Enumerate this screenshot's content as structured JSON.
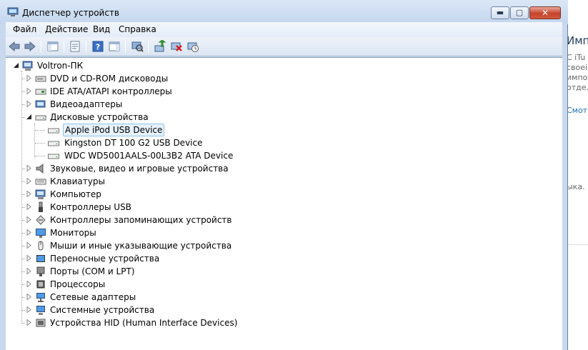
{
  "window": {
    "title": "Диспетчер устройств",
    "caption": {
      "minimize": "▬",
      "maximize": "▢",
      "close": "✕"
    }
  },
  "menu": [
    "Файл",
    "Действие",
    "Вид",
    "Справка"
  ],
  "toolbar": [
    {
      "name": "back-icon"
    },
    {
      "name": "forward-icon"
    },
    {
      "name": "show-hide-tree-icon"
    },
    {
      "name": "properties-icon"
    },
    {
      "name": "help-icon"
    },
    {
      "name": "action-pane-icon"
    },
    {
      "name": "scan-hardware-icon"
    },
    {
      "name": "update-driver-icon"
    },
    {
      "name": "uninstall-icon"
    },
    {
      "name": "disable-device-icon"
    }
  ],
  "tree": {
    "root": "Voltron-ПК",
    "categories": [
      {
        "label": "DVD и CD-ROM дисководы",
        "icon": "dvd-drive-icon",
        "expanded": false
      },
      {
        "label": "IDE ATA/ATAPI контроллеры",
        "icon": "ide-controller-icon",
        "expanded": false
      },
      {
        "label": "Видеоадаптеры",
        "icon": "display-adapter-icon",
        "expanded": false
      },
      {
        "label": "Дисковые устройства",
        "icon": "disk-drive-icon",
        "expanded": true,
        "children": [
          {
            "label": "Apple iPod USB Device",
            "selected": true
          },
          {
            "label": "Kingston DT 100 G2 USB Device"
          },
          {
            "label": "WDC WD5001AALS-00L3B2 ATA Device"
          }
        ]
      },
      {
        "label": "Звуковые, видео и игровые устройства",
        "icon": "sound-icon",
        "expanded": false
      },
      {
        "label": "Клавиатуры",
        "icon": "keyboard-icon",
        "expanded": false
      },
      {
        "label": "Компьютер",
        "icon": "computer-icon",
        "expanded": false
      },
      {
        "label": "Контроллеры USB",
        "icon": "usb-icon",
        "expanded": false
      },
      {
        "label": "Контроллеры запоминающих устройств",
        "icon": "storage-controller-icon",
        "expanded": false
      },
      {
        "label": "Мониторы",
        "icon": "monitor-icon",
        "expanded": false
      },
      {
        "label": "Мыши и иные указывающие устройства",
        "icon": "mouse-icon",
        "expanded": false
      },
      {
        "label": "Переносные устройства",
        "icon": "portable-device-icon",
        "expanded": false
      },
      {
        "label": "Порты (COM и LPT)",
        "icon": "port-icon",
        "expanded": false
      },
      {
        "label": "Процессоры",
        "icon": "processor-icon",
        "expanded": false
      },
      {
        "label": "Сетевые адаптеры",
        "icon": "network-adapter-icon",
        "expanded": false
      },
      {
        "label": "Системные устройства",
        "icon": "system-device-icon",
        "expanded": false
      },
      {
        "label": "Устройства HID (Human Interface Devices)",
        "icon": "hid-icon",
        "expanded": false
      }
    ]
  },
  "background_window": {
    "heading": "Имп",
    "lines": [
      "С iTu",
      "своеі",
      "импо",
      "отде."
    ],
    "link": "Смот",
    "text2": "ыка."
  },
  "colors": {
    "selection_bg": "#e6f1fb",
    "selection_border": "#8cc2ec",
    "frame": "#c8d9ee"
  }
}
